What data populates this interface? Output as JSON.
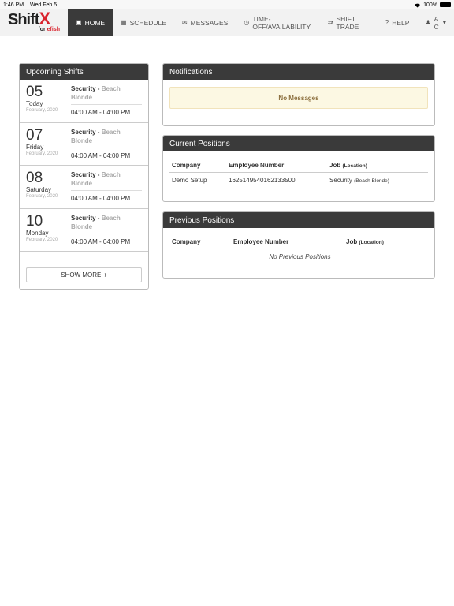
{
  "status": {
    "time": "1:46 PM",
    "date": "Wed Feb 5",
    "battery": "100%",
    "battery_level": 1.0
  },
  "logo": {
    "shift": "Shift",
    "x": "X",
    "for": "for",
    "efish": "efish"
  },
  "nav": {
    "items": [
      {
        "label": "HOME",
        "icon": "dashboard-icon",
        "glyph": "▣"
      },
      {
        "label": "SCHEDULE",
        "icon": "calendar-icon",
        "glyph": "▦"
      },
      {
        "label": "MESSAGES",
        "icon": "envelope-icon",
        "glyph": "✉"
      },
      {
        "label": "TIME-OFF/AVAILABILITY",
        "icon": "clock-icon",
        "glyph": "◷"
      },
      {
        "label": "SHIFT TRADE",
        "icon": "shuffle-icon",
        "glyph": "⇄"
      },
      {
        "label": "HELP",
        "icon": "question-icon",
        "glyph": "?"
      }
    ],
    "user": "A C",
    "user_glyph": "♟",
    "caret": "▾"
  },
  "upcoming": {
    "title": "Upcoming Shifts",
    "shifts": [
      {
        "day": "05",
        "dow": "Today",
        "month": "February, 2020",
        "role": "Security -",
        "location": "Beach Blonde",
        "time": "04:00 AM - 04:00 PM"
      },
      {
        "day": "07",
        "dow": "Friday",
        "month": "February, 2020",
        "role": "Security -",
        "location": "Beach Blonde",
        "time": "04:00 AM - 04:00 PM"
      },
      {
        "day": "08",
        "dow": "Saturday",
        "month": "February, 2020",
        "role": "Security -",
        "location": "Beach Blonde",
        "time": "04:00 AM - 04:00 PM"
      },
      {
        "day": "10",
        "dow": "Monday",
        "month": "February, 2020",
        "role": "Security -",
        "location": "Beach Blonde",
        "time": "04:00 AM - 04:00 PM"
      }
    ],
    "show_more": "SHOW MORE",
    "show_more_glyph": "›"
  },
  "notifications": {
    "title": "Notifications",
    "message": "No Messages"
  },
  "current_positions": {
    "title": "Current Positions",
    "headers": {
      "company": "Company",
      "employee_number": "Employee Number",
      "job": "Job",
      "location": "(Location)"
    },
    "rows": [
      {
        "company": "Demo Setup",
        "employee_number": "1625149540162133500",
        "job": "Security",
        "location": "(Beach Blonde)"
      }
    ]
  },
  "previous_positions": {
    "title": "Previous Positions",
    "headers": {
      "company": "Company",
      "employee_number": "Employee Number",
      "job": "Job",
      "location": "(Location)"
    },
    "empty": "No Previous Positions"
  }
}
